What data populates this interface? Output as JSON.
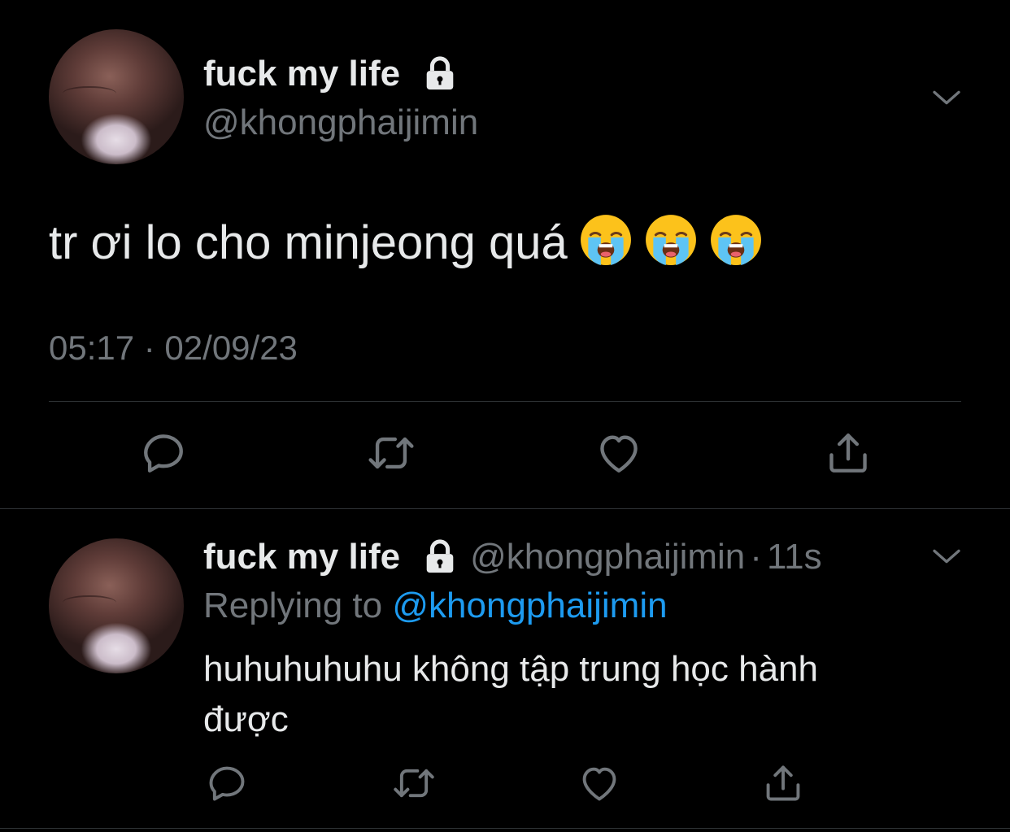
{
  "main_tweet": {
    "display_name": "fuck my life",
    "handle": "@khongphaijimin",
    "text": "tr ơi lo cho minjeong quá",
    "emojis": [
      "loudly-crying-face",
      "loudly-crying-face",
      "loudly-crying-face"
    ],
    "timestamp": "05:17 · 02/09/23",
    "icons": {
      "lock": "lock-icon",
      "more": "chevron-down-icon"
    }
  },
  "actions": [
    "reply-icon",
    "retweet-icon",
    "like-icon",
    "share-icon"
  ],
  "reply_tweet": {
    "display_name": "fuck my life",
    "handle": "@khongphaijimin",
    "time_sep": "·",
    "time": "11s",
    "replying_label": "Replying to",
    "replying_handle": "@khongphaijimin",
    "text_line1": "huhuhuhuhu không tập trung học hành",
    "text_line2": "được"
  },
  "colors": {
    "background": "#000000",
    "text": "#e7e9ea",
    "muted": "#71767b",
    "link": "#1d9bf0",
    "divider": "#2f3336"
  }
}
